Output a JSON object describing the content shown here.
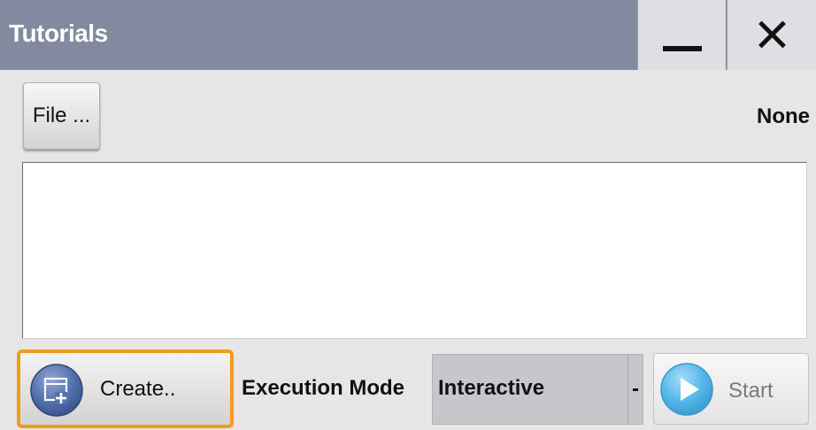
{
  "window": {
    "title": "Tutorials",
    "minimize_icon": "minimize-icon",
    "close_icon": "close-icon"
  },
  "file": {
    "button_label": "File ...",
    "current_file": "None"
  },
  "tutorial_list": {
    "items": []
  },
  "actions": {
    "create_label": "Create..",
    "create_icon": "create-document-icon",
    "execution_mode_label": "Execution Mode",
    "execution_mode_value": "Interactive",
    "start_label": "Start",
    "start_icon": "play-icon"
  },
  "colors": {
    "titlebar": "#818a9e",
    "focus_outline": "#f29b1d",
    "create_icon_blue": "#4e6ea8",
    "start_icon_blue": "#49b3e8"
  }
}
